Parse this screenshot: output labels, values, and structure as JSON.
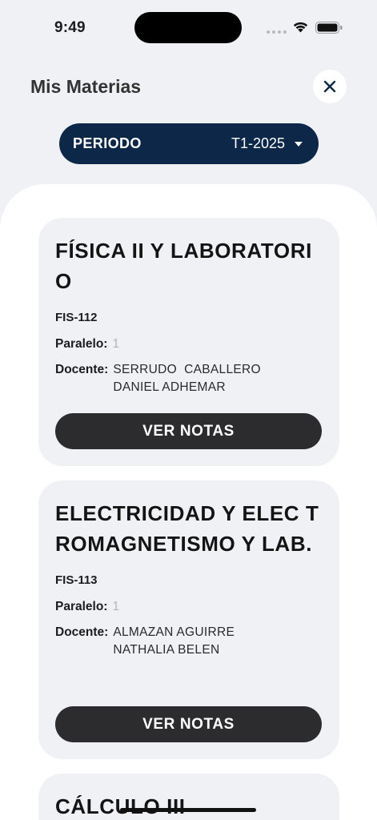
{
  "status_bar": {
    "time": "9:49"
  },
  "header": {
    "title": "Mis Materias"
  },
  "period": {
    "label": "PERIODO",
    "value": "T1-2025"
  },
  "labels": {
    "paralelo": "Paralelo:",
    "docente": "Docente:",
    "ver_notas": "VER NOTAS"
  },
  "courses": [
    {
      "title": "FÍSICA II Y LABORATORIO",
      "code": "FIS-112",
      "paralelo": "1",
      "docente_line1": "SERRUDO  CABALLERO",
      "docente_line2": "DANIEL ADHEMAR"
    },
    {
      "title": "ELECTRICIDAD Y ELEC TROMAGNETISMO Y LAB.",
      "code": "FIS-113",
      "paralelo": "1",
      "docente_line1": "ALMAZAN AGUIRRE",
      "docente_line2": "NATHALIA BELEN"
    },
    {
      "title": "CÁLCULO III"
    }
  ]
}
